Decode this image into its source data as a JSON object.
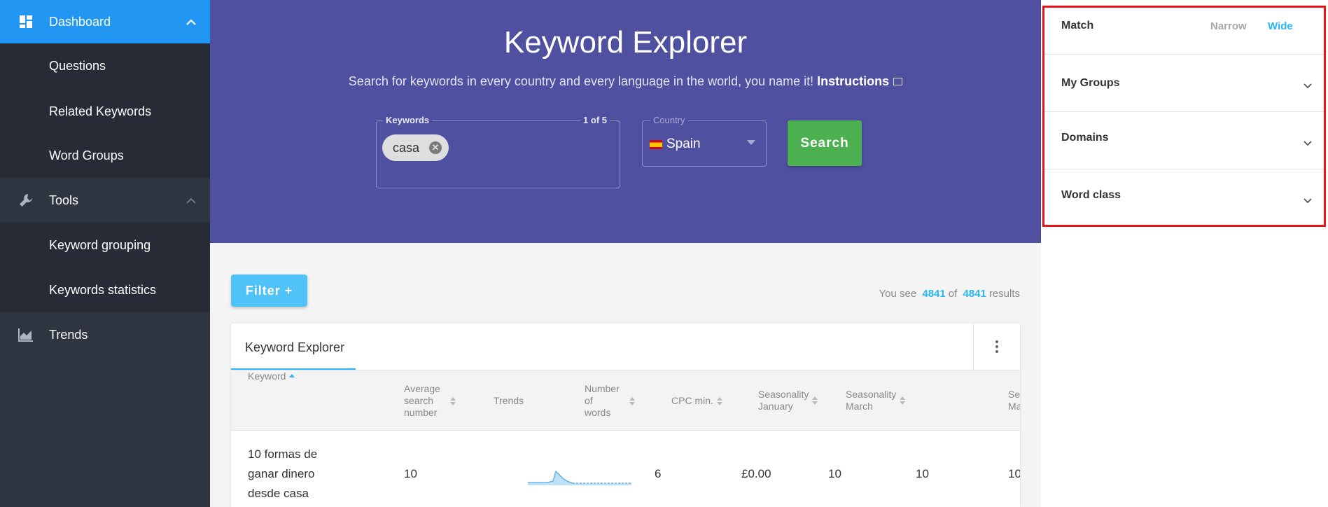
{
  "sidebar": {
    "dashboard": {
      "label": "Dashboard",
      "icon": "dashboard-icon"
    },
    "dashboard_items": [
      "Questions",
      "Related Keywords",
      "Word Groups"
    ],
    "tools": {
      "label": "Tools",
      "icon": "wrench-icon"
    },
    "tools_items": [
      "Keyword grouping",
      "Keywords statistics"
    ],
    "trends": {
      "label": "Trends",
      "icon": "chart-icon"
    }
  },
  "hero": {
    "title": "Keyword Explorer",
    "subtitle": "Search for keywords in every country and every language in the world, you name it!",
    "instructions_link": "Instructions",
    "keywords_label": "Keywords",
    "keywords_count": "1 of 5",
    "keyword_chip": "casa",
    "country_label": "Country",
    "country_value": "Spain",
    "search_button": "Search"
  },
  "toolbar": {
    "filter_button": "Filter",
    "filter_plus": "+",
    "results_prefix": "You see",
    "results_shown": "4841",
    "results_of": "of",
    "results_total": "4841",
    "results_suffix": "results"
  },
  "table": {
    "tab_label": "Keyword Explorer",
    "columns": {
      "keyword": "Keyword",
      "avg_search": [
        "Average",
        "search",
        "number"
      ],
      "trends": "Trends",
      "num_words": [
        "Number",
        "of",
        "words"
      ],
      "cpc_min": "CPC min.",
      "season_jan": [
        "Seasonality",
        "January"
      ],
      "season_mar": [
        "Seasonality",
        "March"
      ],
      "season_cut": [
        "Se",
        "Ma"
      ]
    },
    "rows": [
      {
        "keyword_lines": [
          "10 formas de",
          "ganar dinero",
          "desde casa"
        ],
        "avg_search": "10",
        "num_words": "6",
        "cpc_min": "£0.00",
        "season_jan": "10",
        "season_mar": "10",
        "season_cut": "10"
      }
    ]
  },
  "panel": {
    "match_label": "Match",
    "narrow_option": "Narrow",
    "wide_option": "Wide",
    "sections": [
      "My Groups",
      "Domains",
      "Word class"
    ]
  },
  "colors": {
    "accent": "#29b6f6",
    "sidebar_active": "#2196f3",
    "hero_bg": "#4f51a0",
    "search_green": "#4caf50",
    "highlight_red": "#e8141b"
  }
}
